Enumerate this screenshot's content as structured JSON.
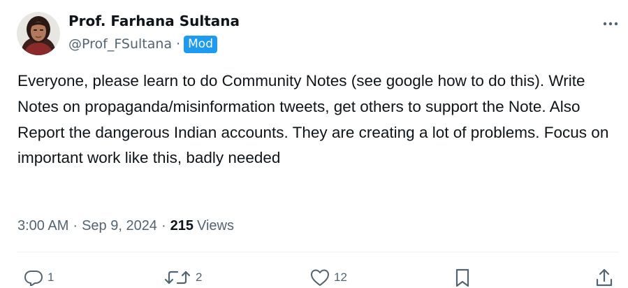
{
  "author": {
    "display_name": "Prof. Farhana Sultana",
    "handle": "@Prof_FSultana",
    "badge": "Mod",
    "separator": "·"
  },
  "tweet": {
    "text": "Everyone, please learn to do Community Notes (see google how to do this). Write Notes on propaganda/misinformation tweets, get others to support the Note. Also Report the dangerous Indian accounts. They are creating a lot of problems. Focus on important work like this, badly needed"
  },
  "meta": {
    "time": "3:00 AM",
    "date": "Sep 9, 2024",
    "separator": "·",
    "views_count": "215",
    "views_label": "Views"
  },
  "actions": {
    "replies": "1",
    "reposts": "2",
    "likes": "12"
  },
  "colors": {
    "text_primary": "#0f1419",
    "text_secondary": "#536471",
    "badge_bg": "#1d9bf0",
    "divider": "#eff3f4"
  },
  "icons": {
    "more": "more-dots-icon",
    "reply": "reply-bubble-icon",
    "repost": "repost-arrows-icon",
    "like": "heart-icon",
    "bookmark": "bookmark-icon",
    "share": "share-upload-icon"
  }
}
